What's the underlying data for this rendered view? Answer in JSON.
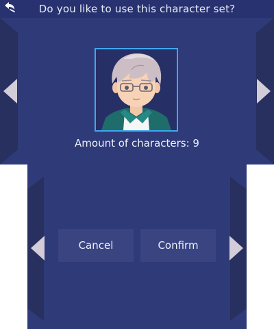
{
  "top_screen": {
    "title": "Do you like to use this character set?",
    "back_icon": "stylus-back-icon",
    "character_count_text": "Amount of characters: 9",
    "portrait": "character-portrait-silver-hair-glasses",
    "left_arrow_icon": "arrow-left-icon",
    "right_arrow_icon": "arrow-right-icon"
  },
  "bottom_screen": {
    "cancel_label": "Cancel",
    "confirm_label": "Confirm",
    "left_arrow_icon": "arrow-left-icon",
    "right_arrow_icon": "arrow-right-icon"
  },
  "colors": {
    "background": "#2f3a78",
    "panel_dark": "#27305f",
    "button": "#3a4480",
    "frame_accent": "#3fa7ef",
    "arrow": "#d3cdd9",
    "text": "#eef1f8"
  }
}
